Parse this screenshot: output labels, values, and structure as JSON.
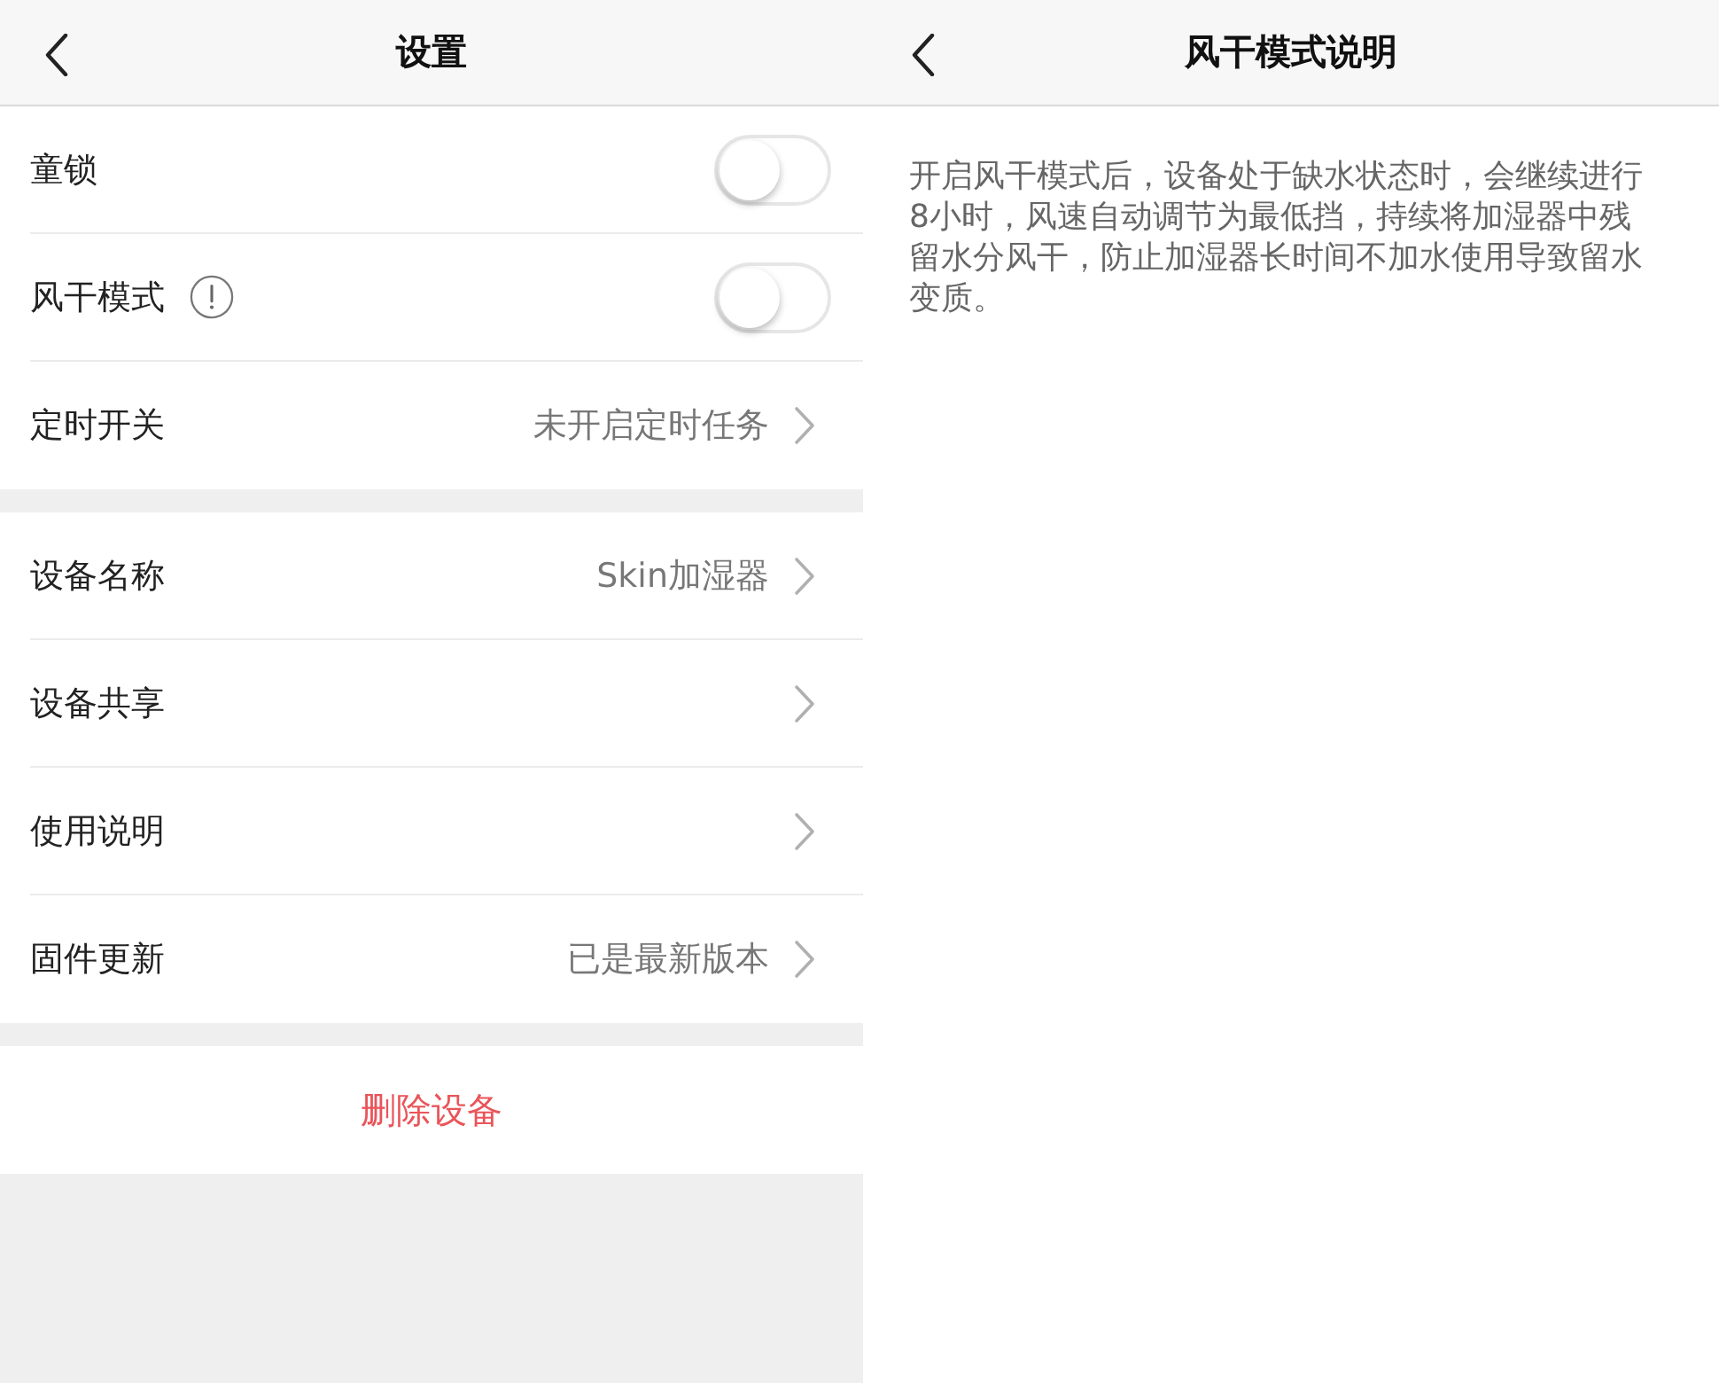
{
  "settings_screen": {
    "nav_bar": {
      "title": "设置"
    },
    "sections": [
      {
        "items": [
          {
            "kind": "toggle",
            "label": "童锁",
            "info": false,
            "on": false
          },
          {
            "kind": "toggle",
            "label": "风干模式",
            "info": true,
            "on": false
          },
          {
            "kind": "link",
            "label": "定时开关",
            "value": "未开启定时任务"
          }
        ]
      },
      {
        "items": [
          {
            "kind": "link",
            "label": "设备名称",
            "value": "Skin加湿器"
          },
          {
            "kind": "link",
            "label": "设备共享"
          },
          {
            "kind": "link",
            "label": "使用说明"
          },
          {
            "kind": "link",
            "label": "固件更新",
            "value": "已是最新版本"
          }
        ]
      }
    ],
    "delete_button": "删除设备"
  },
  "help_screen": {
    "nav_bar": {
      "title": "风干模式说明"
    },
    "description": "开启风干模式后，设备处于缺水状态时，会继续进行8小时，风速自动调节为最低挡，持续将加湿器中残留水分风干，防止加湿器长时间不加水使用导致留水变质。"
  }
}
